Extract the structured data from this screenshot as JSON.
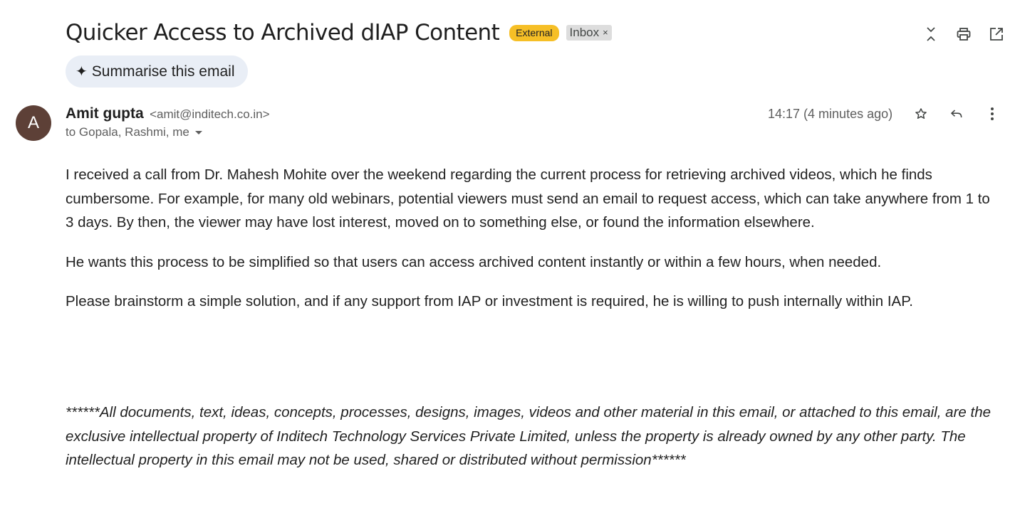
{
  "header": {
    "subject": "Quicker Access to Archived dIAP Content",
    "labels": {
      "external": "External",
      "inbox": "Inbox",
      "inbox_remove": "×"
    },
    "actions": [
      "collapse-icon",
      "print-icon",
      "open-in-new-window-icon"
    ]
  },
  "summarise": {
    "spark": "✦",
    "label": "Summarise this email"
  },
  "message": {
    "avatar_letter": "A",
    "avatar_color": "#5d4037",
    "sender_name": "Amit gupta",
    "sender_email": "<amit@inditech.co.in>",
    "recipients": "to Gopala, Rashmi, me",
    "timestamp": "14:17 (4 minutes ago)",
    "actions": [
      "star-icon",
      "reply-icon",
      "more-vert-icon"
    ]
  },
  "body": {
    "paragraphs": [
      "I received a call from Dr. Mahesh Mohite over the weekend regarding the current process for retrieving archived videos, which he finds cumbersome. For example, for many old webinars, potential viewers must send an email to request access, which can take anywhere from 1 to 3 days. By then, the viewer may have lost interest, moved on to something else, or found the information elsewhere.",
      "He wants this process to be simplified so that users can access archived content instantly or within a few hours, when needed.",
      "Please brainstorm a simple solution, and if any support from IAP or investment is required, he is willing to push internally within IAP."
    ],
    "disclaimer": "******All documents, text, ideas, concepts, processes, designs, images, videos and other material in this email, or attached to this email, are the exclusive intellectual property of Inditech Technology Services Private Limited, unless the property is already owned by any other party. The intellectual property in this email may not be used, shared or distributed without permission******"
  },
  "colors": {
    "external_label": "#f6bf26",
    "inbox_label": "#dddddd",
    "summarise_bg": "#e9eef6"
  }
}
